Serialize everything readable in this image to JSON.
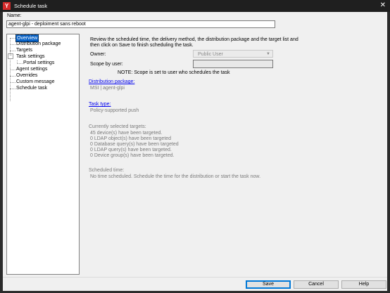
{
  "window": {
    "title": "Schedule task",
    "app_icon": "app-logo-icon",
    "close_glyph": "✕"
  },
  "name_field": {
    "label": "Name:",
    "value": "agent-glpi - deploiment sans reboot"
  },
  "tree": {
    "items": [
      {
        "label": "Overview",
        "selected": true
      },
      {
        "label": "Distribution package"
      },
      {
        "label": "Targets"
      },
      {
        "label": "Task settings",
        "expanded": true,
        "expander": "−"
      },
      {
        "label": "Portal settings"
      },
      {
        "label": "Agent settings"
      },
      {
        "label": "Overrides"
      },
      {
        "label": "Custom message"
      },
      {
        "label": "Schedule task"
      }
    ]
  },
  "overview": {
    "intro_line1": "Review the scheduled time, the delivery method, the distribution package and the target list and",
    "intro_line2": "then click on Save to finish scheduling the task.",
    "owner_label": "Owner:",
    "owner_value": "Public User",
    "scope_label": "Scope by user:",
    "scope_note": "NOTE: Scope is set to user who schedules the task",
    "distribution_package_link": "Distribution package:",
    "distribution_package_value": "MSI | agent-glpi",
    "task_type_link": "Task type:",
    "task_type_value": "Policy-supported push",
    "targets_heading": "Currently selected targets:",
    "targets": [
      "45 device(s) have been targeted.",
      "0 LDAP object(s) have been targeted",
      "0 Database query(s) have been targeted",
      "0 LDAP query(s) have been targeted.",
      "0 Device group(s) have been targeted."
    ],
    "scheduled_heading": "Scheduled time:",
    "scheduled_value": "No time scheduled. Schedule the time for the distribution or start the task now."
  },
  "buttons": {
    "save": "Save",
    "cancel": "Cancel",
    "help": "Help"
  },
  "colors": {
    "selection": "#0a64c8",
    "link": "#0000ee",
    "app_icon": "#d42a2a"
  }
}
